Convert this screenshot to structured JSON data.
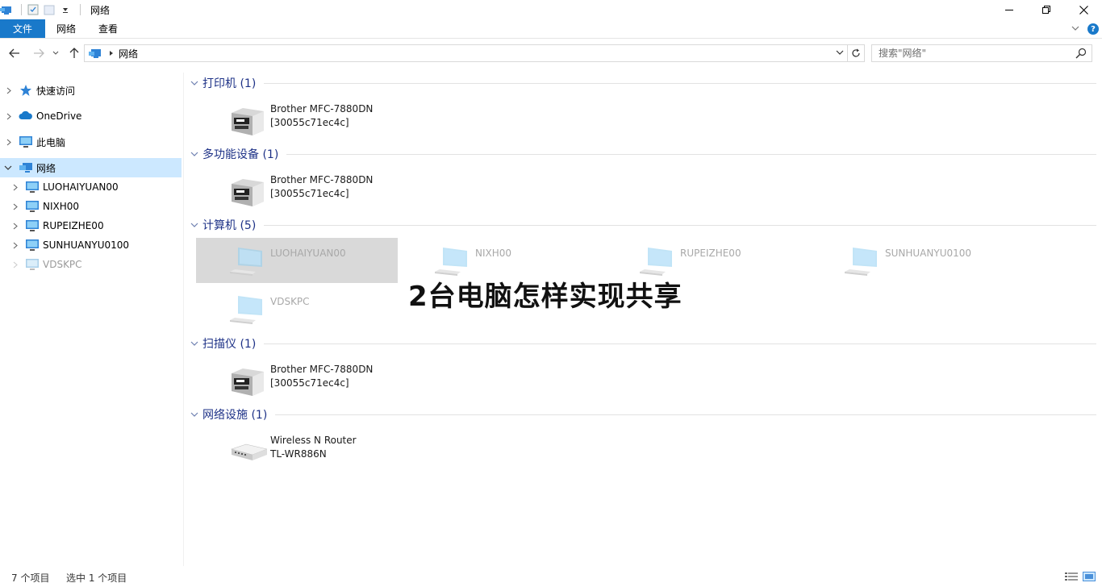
{
  "window": {
    "title": "网络",
    "controls": {
      "minimize": "minimize-icon",
      "restore": "restore-icon",
      "close": "close-icon"
    }
  },
  "ribbon": {
    "tabs": [
      {
        "label": "文件",
        "active": true
      },
      {
        "label": "网络"
      },
      {
        "label": "查看"
      }
    ],
    "help": "?"
  },
  "address": {
    "breadcrumb": "网络",
    "search_placeholder": "搜索\"网络\""
  },
  "sidebar": {
    "items": [
      {
        "label": "快速访问",
        "icon": "star-icon"
      },
      {
        "label": "OneDrive",
        "icon": "cloud-icon"
      },
      {
        "label": "此电脑",
        "icon": "computer-icon"
      },
      {
        "label": "网络",
        "icon": "network-icon",
        "selected": true,
        "expanded": true
      },
      {
        "label": "LUOHAIYUAN00",
        "icon": "computer-icon"
      },
      {
        "label": "NIXH00",
        "icon": "computer-icon"
      },
      {
        "label": "RUPEIZHE00",
        "icon": "computer-icon"
      },
      {
        "label": "SUNHUANYU0100",
        "icon": "computer-icon"
      },
      {
        "label": "VDSKPC",
        "icon": "computer-icon",
        "dim": true
      }
    ]
  },
  "groups": [
    {
      "header": "打印机 (1)",
      "items": [
        {
          "line1": "Brother MFC-7880DN",
          "line2": "[30055c71ec4c]",
          "icon": "printer-icon"
        }
      ]
    },
    {
      "header": "多功能设备 (1)",
      "items": [
        {
          "line1": "Brother MFC-7880DN",
          "line2": "[30055c71ec4c]",
          "icon": "printer-icon"
        }
      ]
    },
    {
      "header": "计算机 (5)",
      "items": [
        {
          "line1": "LUOHAIYUAN00",
          "icon": "computer-icon",
          "selected": true
        },
        {
          "line1": "NIXH00",
          "icon": "computer-icon"
        },
        {
          "line1": "RUPEIZHE00",
          "icon": "computer-icon"
        },
        {
          "line1": "SUNHUANYU0100",
          "icon": "computer-icon"
        },
        {
          "line1": "VDSKPC",
          "icon": "computer-icon"
        }
      ]
    },
    {
      "header": "扫描仪 (1)",
      "items": [
        {
          "line1": "Brother MFC-7880DN",
          "line2": "[30055c71ec4c]",
          "icon": "printer-icon"
        }
      ]
    },
    {
      "header": "网络设施 (1)",
      "items": [
        {
          "line1": "Wireless N Router",
          "line2": "TL-WR886N",
          "icon": "router-icon"
        }
      ]
    }
  ],
  "overlay_title": "2台电脑怎样实现共享",
  "status": {
    "item_count": "7 个项目",
    "selection": "选中 1 个项目"
  },
  "colors": {
    "accent": "#1979ca",
    "selection": "#cce8ff",
    "group_header": "#1e3287"
  }
}
